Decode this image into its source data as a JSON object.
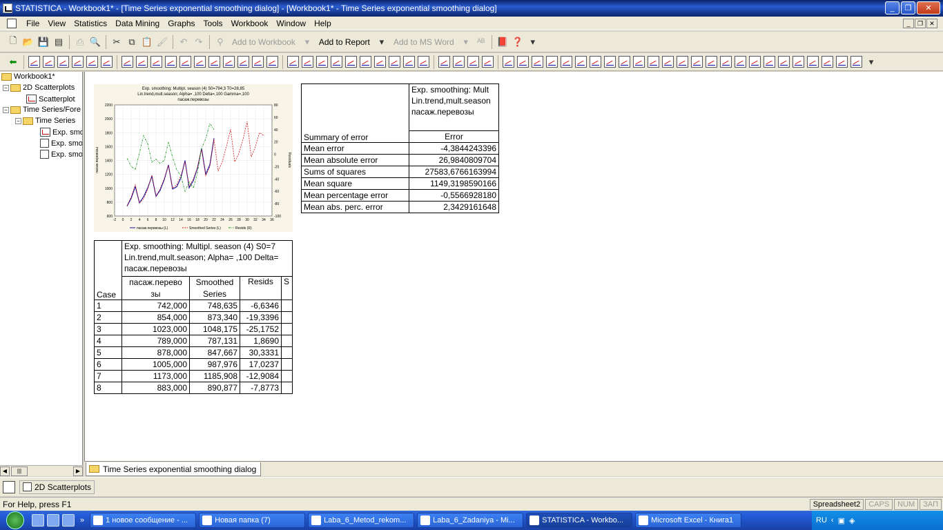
{
  "window": {
    "title": "STATISTICA - Workbook1* - [Time Series exponential smoothing dialog] - [Workbook1* - Time Series exponential smoothing dialog]"
  },
  "menu": [
    "File",
    "View",
    "Statistics",
    "Data Mining",
    "Graphs",
    "Tools",
    "Workbook",
    "Window",
    "Help"
  ],
  "toolbar": {
    "add_to_workbook": "Add to Workbook",
    "add_to_report": "Add to Report",
    "add_to_msword": "Add to MS Word"
  },
  "tree": {
    "root": "Workbook1*",
    "n1": "2D Scatterplots",
    "n1_child": "Scatterplot",
    "n2": "Time Series/Fore",
    "n2_child": "Time Series",
    "leaf1": "Exp. smo",
    "leaf2": "Exp. smo",
    "leaf3": "Exp. smo"
  },
  "chart_data": {
    "type": "line",
    "title": "Exp. smoothing: Multipl. season (4) S0=794,3 T0=28,85",
    "subtitle": "Lin.trend,mult.season; Alpha= ,100 Delta=,100 Gamma=,100",
    "subtitle2": "пасаж.перевозы",
    "ylabel": "пасаж.перевозы",
    "y2label": "Residuals",
    "xlim": [
      -2,
      36
    ],
    "ylim": [
      600,
      2200
    ],
    "y2lim": [
      -100,
      80
    ],
    "xticks": [
      "-2",
      "0",
      "2",
      "4",
      "6",
      "8",
      "10",
      "12",
      "14",
      "16",
      "18",
      "20",
      "22",
      "24",
      "26",
      "28",
      "30",
      "32",
      "34",
      "36"
    ],
    "yticks": [
      "600",
      "800",
      "1000",
      "1200",
      "1400",
      "1600",
      "1800",
      "2000",
      "2200"
    ],
    "y2ticks": [
      "-100",
      "-80",
      "-60",
      "-40",
      "-20",
      "0",
      "20",
      "40",
      "60",
      "80"
    ],
    "legend": [
      "пасаж.перевозы (L)",
      "Smoothed Series (L)",
      "Resids (R)"
    ],
    "series": [
      {
        "name": "пасаж.перевозы (L)",
        "x": [
          1,
          2,
          3,
          4,
          5,
          6,
          7,
          8,
          9,
          10,
          11,
          12,
          13,
          14,
          15,
          16,
          17,
          18,
          19,
          20,
          21,
          22
        ],
        "values": [
          742,
          854,
          1023,
          789,
          878,
          1005,
          1173,
          883,
          972,
          1125,
          1336,
          988,
          1020,
          1146,
          1400,
          1006,
          1108,
          1288,
          1570,
          1200,
          1340,
          1720
        ]
      },
      {
        "name": "Smoothed Series (L)",
        "x": [
          1,
          2,
          3,
          4,
          5,
          6,
          7,
          8,
          9,
          10,
          11,
          12,
          13,
          14,
          15,
          16,
          17,
          18,
          19,
          20,
          21,
          22,
          23,
          24,
          25,
          26,
          27,
          28,
          29,
          30,
          31,
          32,
          33,
          34
        ],
        "values": [
          748.6,
          873.3,
          1048.2,
          787.1,
          847.7,
          988,
          1185.9,
          890.9,
          990,
          1140,
          1330,
          1000,
          1050,
          1180,
          1380,
          1030,
          1130,
          1300,
          1560,
          1180,
          1310,
          1700,
          1250,
          1380,
          1600,
          1850,
          1380,
          1500,
          1700,
          1960,
          1450,
          1600,
          1800,
          1760
        ]
      },
      {
        "name": "Resids (R)",
        "x": [
          1,
          2,
          3,
          4,
          5,
          6,
          7,
          8,
          9,
          10,
          11,
          12,
          13,
          14,
          15,
          16,
          17,
          18,
          19,
          20,
          21,
          22
        ],
        "values": [
          -6.6,
          -19.3,
          -25.2,
          1.9,
          30.3,
          17.0,
          -12.9,
          -7.9,
          -15,
          -10,
          20,
          -5,
          -25,
          -35,
          -60,
          -45,
          -55,
          -30,
          10,
          25,
          50,
          40
        ]
      }
    ]
  },
  "summary": {
    "h1": "Exp. smoothing: Mult",
    "h2": "Lin.trend,mult.season",
    "h3": "пасаж.перевозы",
    "corner": "Summary of error",
    "col": "Error",
    "rows": [
      {
        "label": "Mean error",
        "value": "-4,3844243396"
      },
      {
        "label": "Mean absolute error",
        "value": "26,9840809704"
      },
      {
        "label": "Sums of squares",
        "value": "27583,6766163994"
      },
      {
        "label": "Mean square",
        "value": "1149,3198590166"
      },
      {
        "label": "Mean percentage error",
        "value": "-0,5566928180"
      },
      {
        "label": "Mean abs. perc. error",
        "value": "2,3429161648"
      }
    ]
  },
  "cases": {
    "h1": "Exp. smoothing: Multipl. season (4) S0=7",
    "h2": "Lin.trend,mult.season; Alpha= ,100 Delta=",
    "h3": "пасаж.перевозы",
    "corner": "Case",
    "c1a": "пасаж.перево",
    "c1b": "зы",
    "c2a": "Smoothed",
    "c2b": "Series",
    "c3": "Resids",
    "c4": "S",
    "rows": [
      [
        "1",
        "742,000",
        "748,635",
        "-6,6346"
      ],
      [
        "2",
        "854,000",
        "873,340",
        "-19,3396"
      ],
      [
        "3",
        "1023,000",
        "1048,175",
        "-25,1752"
      ],
      [
        "4",
        "789,000",
        "787,131",
        "1,8690"
      ],
      [
        "5",
        "878,000",
        "847,667",
        "30,3331"
      ],
      [
        "6",
        "1005,000",
        "987,976",
        "17,0237"
      ],
      [
        "7",
        "1173,000",
        "1185,908",
        "-12,9084"
      ],
      [
        "8",
        "883,000",
        "890,877",
        "-7,8773"
      ]
    ]
  },
  "tab": {
    "label": "Time Series exponential smoothing dialog"
  },
  "docbar": {
    "item": "2D Scatterplots"
  },
  "status": {
    "help": "For Help, press F1",
    "pane1": "Spreadsheet2",
    "pane2": "CAPS",
    "pane3": "NUM",
    "pane4": "ЗАП"
  },
  "taskbar": {
    "items": [
      "1 новое сообщение - ...",
      "Новая папка (7)",
      "Laba_6_Metod_rekom...",
      "Laba_6_Zadaniya - Mi...",
      "STATISTICA - Workbo...",
      "Microsoft Excel - Книга1"
    ],
    "lang": "RU"
  }
}
